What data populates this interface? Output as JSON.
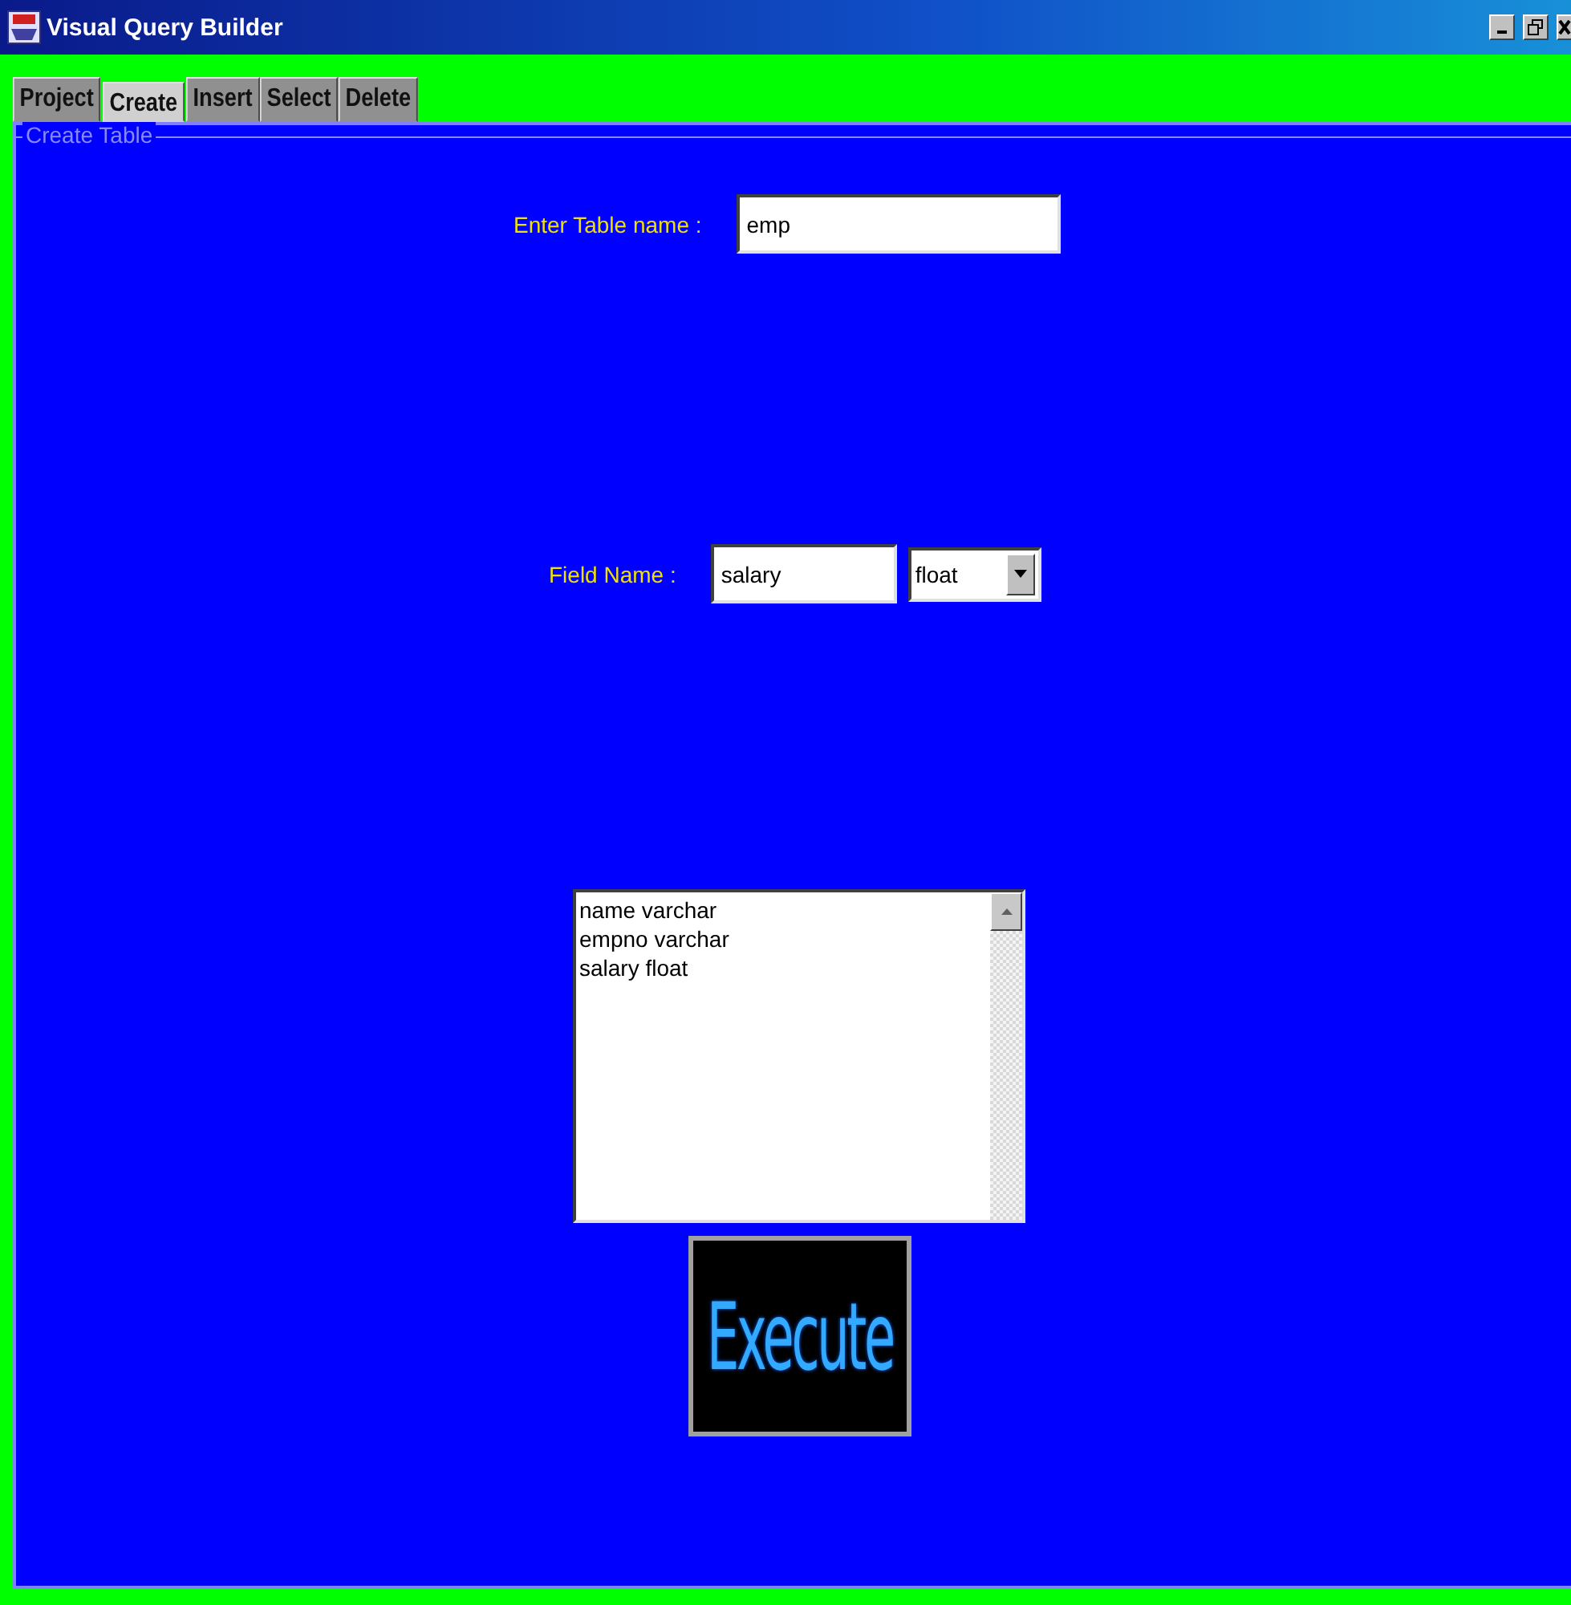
{
  "window": {
    "title": "Visual Query Builder"
  },
  "tabs": [
    {
      "label": "Project",
      "selected": false
    },
    {
      "label": "Create",
      "selected": true
    },
    {
      "label": "Insert",
      "selected": false
    },
    {
      "label": "Select",
      "selected": false
    },
    {
      "label": "Delete",
      "selected": false
    }
  ],
  "panel": {
    "title": "Create Table",
    "table_name": {
      "label": "Enter Table name :",
      "value": "emp"
    },
    "field": {
      "label": "Field Name :",
      "value": "salary",
      "type": "float"
    },
    "fields_list": [
      "name varchar",
      "empno varchar",
      "salary float"
    ],
    "execute_button": "Execute"
  }
}
